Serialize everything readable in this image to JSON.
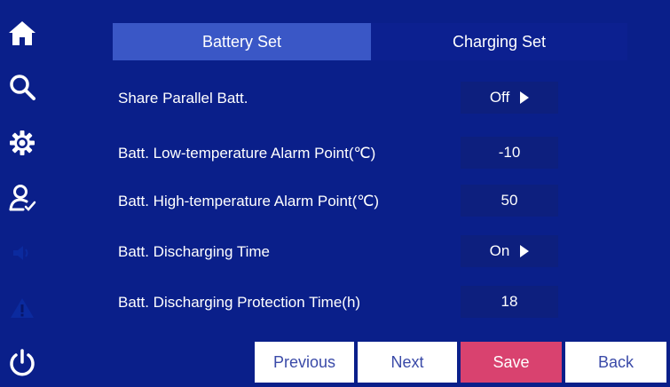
{
  "sidebar": {
    "icons": [
      "home-icon",
      "search-icon",
      "gear-icon",
      "user-check-icon",
      "speaker-icon",
      "warning-icon",
      "power-icon"
    ]
  },
  "tabs": [
    {
      "label": "Battery Set",
      "active": true
    },
    {
      "label": "Charging Set",
      "active": false
    }
  ],
  "rows": [
    {
      "label": "Share Parallel Batt.",
      "value": "Off",
      "has_arrow": true
    },
    {
      "label": "Batt. Low-temperature Alarm Point(℃)",
      "value": "-10",
      "has_arrow": false
    },
    {
      "label": "Batt. High-temperature Alarm Point(℃)",
      "value": "50",
      "has_arrow": false
    },
    {
      "label": "Batt. Discharging Time",
      "value": "On",
      "has_arrow": true
    },
    {
      "label": "Batt. Discharging Protection Time(h)",
      "value": "18",
      "has_arrow": false
    }
  ],
  "footer": {
    "previous_label": "Previous",
    "next_label": "Next",
    "save_label": "Save",
    "back_label": "Back"
  },
  "colors": {
    "background": "#0a1f8a",
    "active_tab": "#3a57c6",
    "save": "#d9426f"
  }
}
